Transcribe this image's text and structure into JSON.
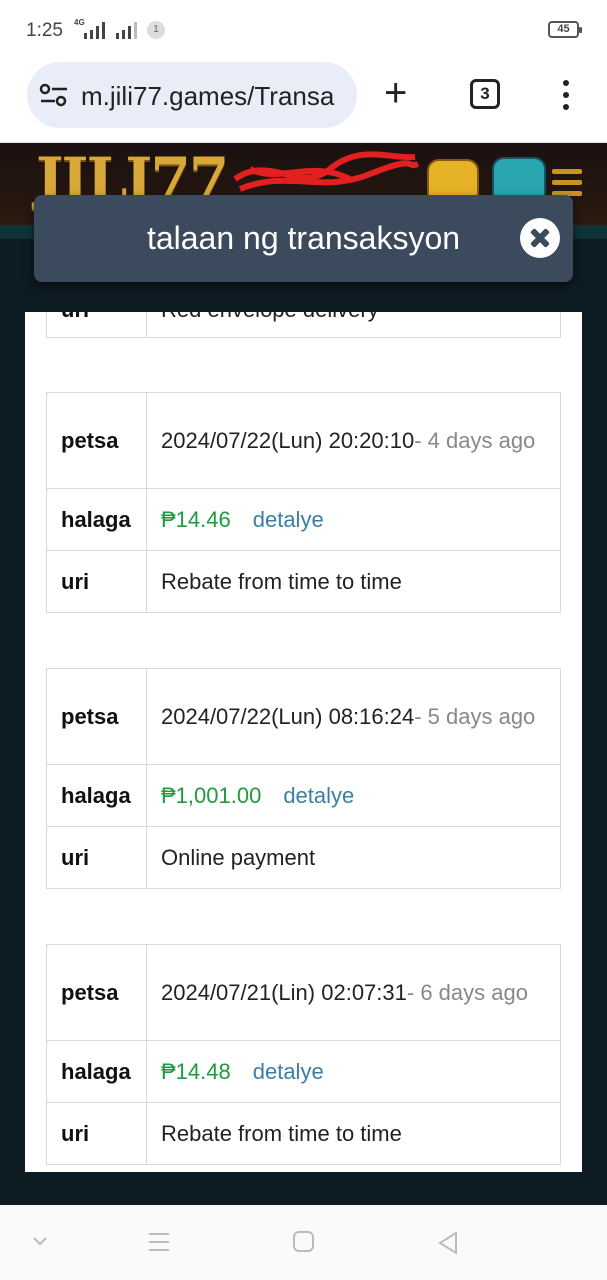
{
  "status_bar": {
    "time": "1:25",
    "network": "4G",
    "notification_count": "1",
    "battery": "45"
  },
  "browser": {
    "url": "m.jili77.games/Transa",
    "tab_count": "3"
  },
  "site": {
    "logo_text": "JILI77"
  },
  "modal": {
    "title": "talaan ng transaksyon",
    "partial_row_label": "uri",
    "partial_row_value": "Red envelope delivery",
    "transactions": [
      {
        "date_label": "petsa",
        "date": "2024/07/22(Lun) 20:20:10",
        "ago": "- 4 days ago",
        "amount_label": "halaga",
        "amount": "₱14.46",
        "detail_link": "detalye",
        "type_label": "uri",
        "type": "Rebate from time to time"
      },
      {
        "date_label": "petsa",
        "date": "2024/07/22(Lun) 08:16:24",
        "ago": "- 5 days ago",
        "amount_label": "halaga",
        "amount": "₱1,001.00",
        "detail_link": "detalye",
        "type_label": "uri",
        "type": "Online payment"
      },
      {
        "date_label": "petsa",
        "date": "2024/07/21(Lin) 02:07:31",
        "ago": "- 6 days ago",
        "amount_label": "halaga",
        "amount": "₱14.48",
        "detail_link": "detalye",
        "type_label": "uri",
        "type": "Rebate from time to time"
      }
    ]
  },
  "colors": {
    "amount": "#1f9a3c",
    "link": "#3b7fa6",
    "modal_header": "#3b4a5c",
    "site_bg": "#0d1b22"
  }
}
